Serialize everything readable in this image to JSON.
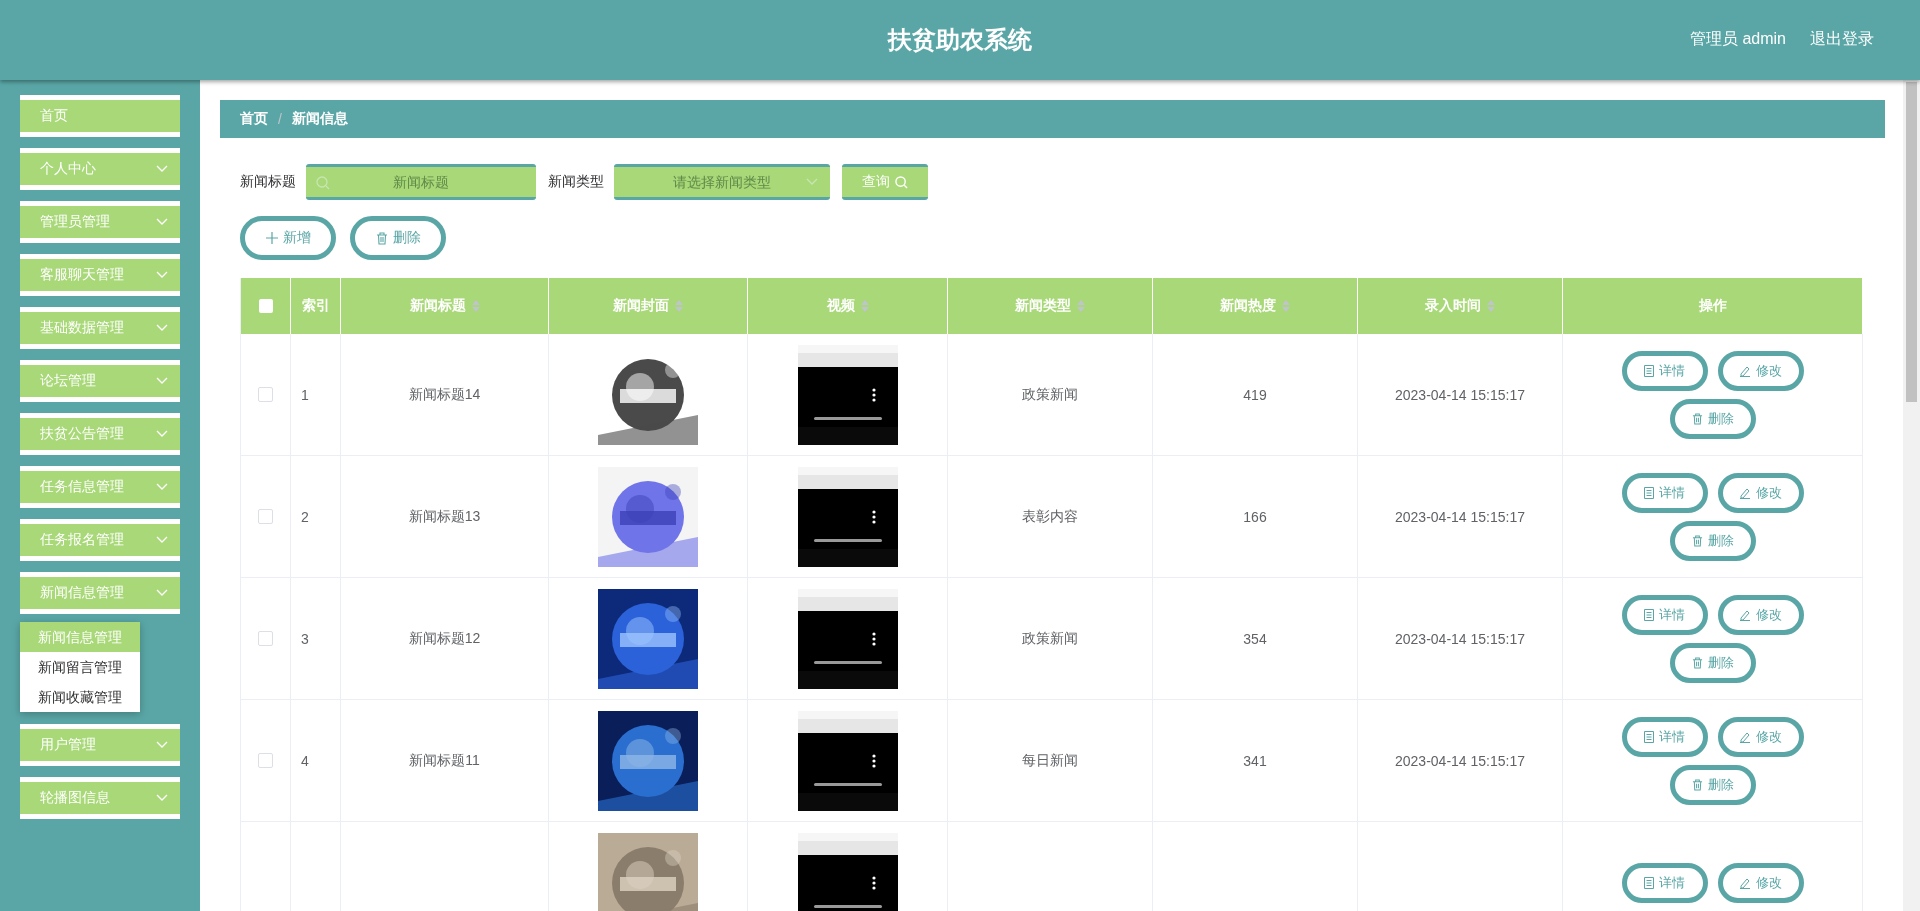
{
  "header": {
    "title": "扶贫助农系统",
    "user": "管理员 admin",
    "logout": "退出登录"
  },
  "sidebar": {
    "items": [
      {
        "label": "首页",
        "kind": "link"
      },
      {
        "label": "个人中心",
        "kind": "submenu"
      },
      {
        "label": "管理员管理",
        "kind": "submenu"
      },
      {
        "label": "客服聊天管理",
        "kind": "submenu"
      },
      {
        "label": "基础数据管理",
        "kind": "submenu"
      },
      {
        "label": "论坛管理",
        "kind": "submenu"
      },
      {
        "label": "扶贫公告管理",
        "kind": "submenu"
      },
      {
        "label": "任务信息管理",
        "kind": "submenu"
      },
      {
        "label": "任务报名管理",
        "kind": "submenu"
      },
      {
        "label": "新闻信息管理",
        "kind": "submenu",
        "children": [
          {
            "label": "新闻信息管理",
            "selected": true
          },
          {
            "label": "新闻留言管理",
            "selected": false
          },
          {
            "label": "新闻收藏管理",
            "selected": false
          }
        ]
      },
      {
        "label": "用户管理",
        "kind": "submenu"
      },
      {
        "label": "轮播图信息",
        "kind": "submenu"
      }
    ]
  },
  "breadcrumb": {
    "separator": "/",
    "items": [
      "首页",
      "新闻信息"
    ]
  },
  "search": {
    "fields": [
      {
        "label": "新闻标题",
        "kind": "input",
        "placeholder": "新闻标题"
      },
      {
        "label": "新闻类型",
        "kind": "select",
        "placeholder": "请选择新闻类型"
      }
    ],
    "button": "查询"
  },
  "actions": [
    {
      "label": "新增",
      "kind": "add"
    },
    {
      "label": "删除",
      "kind": "delete"
    }
  ],
  "table": {
    "select_all": {
      "checked": false
    },
    "columns": [
      {
        "label": "索引",
        "sortable": false
      },
      {
        "label": "新闻标题",
        "sortable": true
      },
      {
        "label": "新闻封面",
        "sortable": true
      },
      {
        "label": "视频",
        "sortable": true
      },
      {
        "label": "新闻类型",
        "sortable": true
      },
      {
        "label": "新闻热度",
        "sortable": true
      },
      {
        "label": "录入时间",
        "sortable": true
      },
      {
        "label": "操作",
        "sortable": false
      }
    ],
    "rows": [
      {
        "checked": false,
        "index": "1",
        "title": "新闻标题14",
        "type": "政策新闻",
        "heat": "419",
        "time": "2023-04-14 15:15:17",
        "actions": [
          {
            "label": "详情",
            "kind": "detail"
          },
          {
            "label": "修改",
            "kind": "edit"
          },
          {
            "label": "删除",
            "kind": "delete"
          }
        ]
      },
      {
        "checked": false,
        "index": "2",
        "title": "新闻标题13",
        "type": "表彰内容",
        "heat": "166",
        "time": "2023-04-14 15:15:17",
        "actions": [
          {
            "label": "详情",
            "kind": "detail"
          },
          {
            "label": "修改",
            "kind": "edit"
          },
          {
            "label": "删除",
            "kind": "delete"
          }
        ]
      },
      {
        "checked": false,
        "index": "3",
        "title": "新闻标题12",
        "type": "政策新闻",
        "heat": "354",
        "time": "2023-04-14 15:15:17",
        "actions": [
          {
            "label": "详情",
            "kind": "detail"
          },
          {
            "label": "修改",
            "kind": "edit"
          },
          {
            "label": "删除",
            "kind": "delete"
          }
        ]
      },
      {
        "checked": false,
        "index": "4",
        "title": "新闻标题11",
        "type": "每日新闻",
        "heat": "341",
        "time": "2023-04-14 15:15:17",
        "actions": [
          {
            "label": "详情",
            "kind": "detail"
          },
          {
            "label": "修改",
            "kind": "edit"
          },
          {
            "label": "删除",
            "kind": "delete"
          }
        ]
      },
      {
        "actions": [
          {
            "label": "详情",
            "kind": "detail"
          },
          {
            "label": "修改",
            "kind": "edit"
          }
        ]
      }
    ]
  }
}
